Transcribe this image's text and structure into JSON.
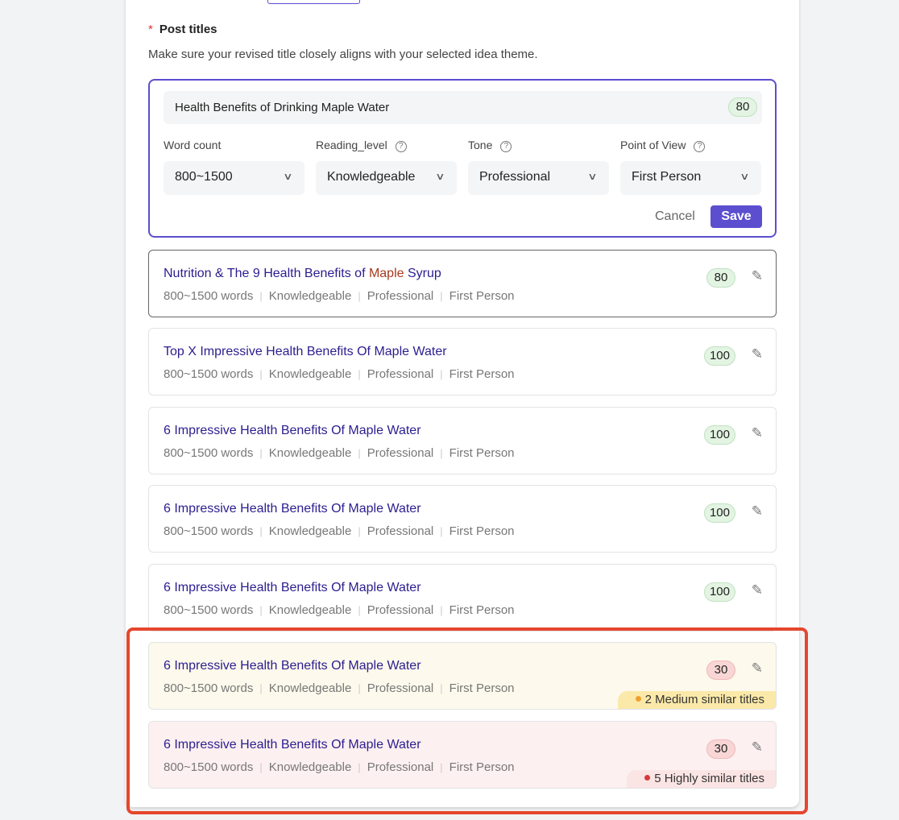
{
  "section": {
    "required_mark": "*",
    "title": "Post titles",
    "description": "Make sure your revised title closely aligns with your selected idea theme."
  },
  "editor": {
    "title_value": "Health Benefits of Drinking Maple Water",
    "score": "80",
    "fields": [
      {
        "label": "Word count",
        "value": "800~1500",
        "help": false
      },
      {
        "label": "Reading_level",
        "value": "Knowledgeable",
        "help": true
      },
      {
        "label": "Tone",
        "value": "Professional",
        "help": true
      },
      {
        "label": "Point of View",
        "value": "First Person",
        "help": true
      }
    ],
    "cancel_label": "Cancel",
    "save_label": "Save"
  },
  "cards": [
    {
      "title_parts": [
        "Nutrition & The 9 Health Benefits of ",
        "Maple",
        " Syrup"
      ],
      "meta": [
        "800~1500 words",
        "Knowledgeable",
        "Professional",
        "First Person"
      ],
      "score": "80",
      "score_color": "green"
    },
    {
      "title": "Top X Impressive Health Benefits Of Maple Water",
      "meta": [
        "800~1500 words",
        "Knowledgeable",
        "Professional",
        "First Person"
      ],
      "score": "100",
      "score_color": "green"
    },
    {
      "title": "6 Impressive Health Benefits Of Maple Water",
      "meta": [
        "800~1500 words",
        "Knowledgeable",
        "Professional",
        "First Person"
      ],
      "score": "100",
      "score_color": "green"
    },
    {
      "title": "6 Impressive Health Benefits Of Maple Water",
      "meta": [
        "800~1500 words",
        "Knowledgeable",
        "Professional",
        "First Person"
      ],
      "score": "100",
      "score_color": "green"
    },
    {
      "title": "6 Impressive Health Benefits Of Maple Water",
      "meta": [
        "800~1500 words",
        "Knowledgeable",
        "Professional",
        "First Person"
      ],
      "score": "100",
      "score_color": "green"
    },
    {
      "title": "6 Impressive Health Benefits Of Maple Water",
      "meta": [
        "800~1500 words",
        "Knowledgeable",
        "Professional",
        "First Person"
      ],
      "score": "30",
      "score_color": "red",
      "similarity": "2 Medium similar titles",
      "similarity_color": "#f0a030"
    },
    {
      "title": "6 Impressive Health Benefits Of Maple Water",
      "meta": [
        "800~1500 words",
        "Knowledgeable",
        "Professional",
        "First Person"
      ],
      "score": "30",
      "score_color": "red",
      "similarity": "5 Highly similar titles",
      "similarity_color": "#d63a3a"
    }
  ],
  "colors": {
    "accent": "#5b4fcf",
    "annotation": "#e5472e",
    "title_link": "#2b1d8f"
  }
}
